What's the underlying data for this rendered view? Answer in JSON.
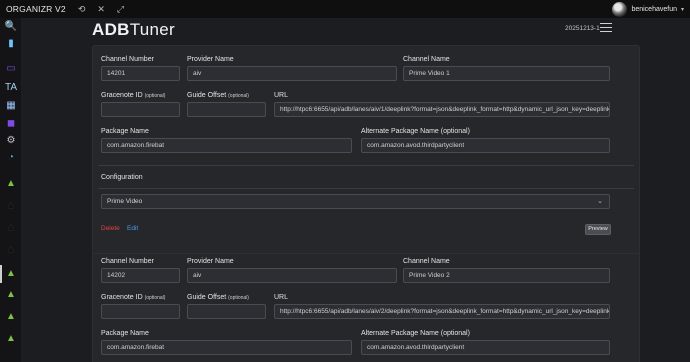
{
  "topbar": {
    "app_name": "ORGANIZR V2",
    "icons": [
      "refresh-icon",
      "close-icon",
      "expand-icon"
    ],
    "user_name": "benicehavefun",
    "user_caret": "▾"
  },
  "dock": {
    "items": [
      {
        "icon": "search-app-icon",
        "glyph": "🔍",
        "color": "#e0a030"
      },
      {
        "icon": "battery-app-icon",
        "glyph": "▮",
        "color": "#6fc3ff"
      },
      {
        "icon": "ticket-app-icon",
        "glyph": "▭",
        "color": "#7a4fd8"
      },
      {
        "icon": "ta-app-icon",
        "glyph": "TA",
        "color": "#9fd0f0"
      },
      {
        "icon": "windows-app-icon",
        "glyph": "▦",
        "color": "#9fc7ff"
      },
      {
        "icon": "grid-app-icon",
        "glyph": "◼",
        "color": "#7b4de0"
      },
      {
        "icon": "settings-app-icon",
        "glyph": "⚙",
        "color": "#bfc3c9"
      },
      {
        "icon": "gauge-app-icon",
        "glyph": "◔",
        "color": "#3fb2d0"
      },
      {
        "icon": "android-app-icon",
        "glyph": "▲",
        "color": "#7bc343"
      },
      {
        "icon": "android-dark-app-icon",
        "glyph": "▲",
        "color": "#111111"
      },
      {
        "icon": "android-dark-app-icon",
        "glyph": "▲",
        "color": "#111111"
      },
      {
        "icon": "android-dark-app-icon",
        "glyph": "▲",
        "color": "#111111"
      },
      {
        "icon": "android-app-icon",
        "glyph": "▲",
        "color": "#7bc343"
      },
      {
        "icon": "android-app-icon",
        "glyph": "▲",
        "color": "#7bc343"
      },
      {
        "icon": "android-app-icon",
        "glyph": "▲",
        "color": "#7bc343"
      },
      {
        "icon": "android-app-icon",
        "glyph": "▲",
        "color": "#7bc343"
      }
    ]
  },
  "header": {
    "brand_bold": "ADB",
    "brand_light": "Tuner",
    "version": "20251213-1"
  },
  "labels": {
    "channel_number": "Channel Number",
    "provider_name": "Provider Name",
    "channel_name": "Channel Name",
    "gracenote_id": "Gracenote ID",
    "gracenote_optional": "(optional)",
    "guide_offset": "Guide Offset",
    "guide_optional": "(optional)",
    "url": "URL",
    "package_name": "Package Name",
    "alt_package_name": "Alternate Package Name (optional)",
    "configuration": "Configuration",
    "delete": "Delete",
    "edit": "Edit",
    "preview": "Preview"
  },
  "channels": [
    {
      "channel_number": "14201",
      "provider_name": "aiv",
      "channel_name": "Prime Video 1",
      "gracenote_id": "",
      "guide_offset": "",
      "url": "http://htpc6:6655/api/adb/lanes/aiv/1/deeplink?format=json&deeplink_format=http&dynamic_url_json_key=deeplink",
      "package_name": "com.amazon.firebat",
      "alt_package_name": "com.amazon.avod.thirdpartyclient",
      "configuration": "Prime Video"
    },
    {
      "channel_number": "14202",
      "provider_name": "aiv",
      "channel_name": "Prime Video 2",
      "gracenote_id": "",
      "guide_offset": "",
      "url": "http://htpc6:6655/api/adb/lanes/aiv/2/deeplink?format=json&deeplink_format=http&dynamic_url_json_key=deeplink",
      "package_name": "com.amazon.firebat",
      "alt_package_name": "com.amazon.avod.thirdpartyclient"
    }
  ]
}
